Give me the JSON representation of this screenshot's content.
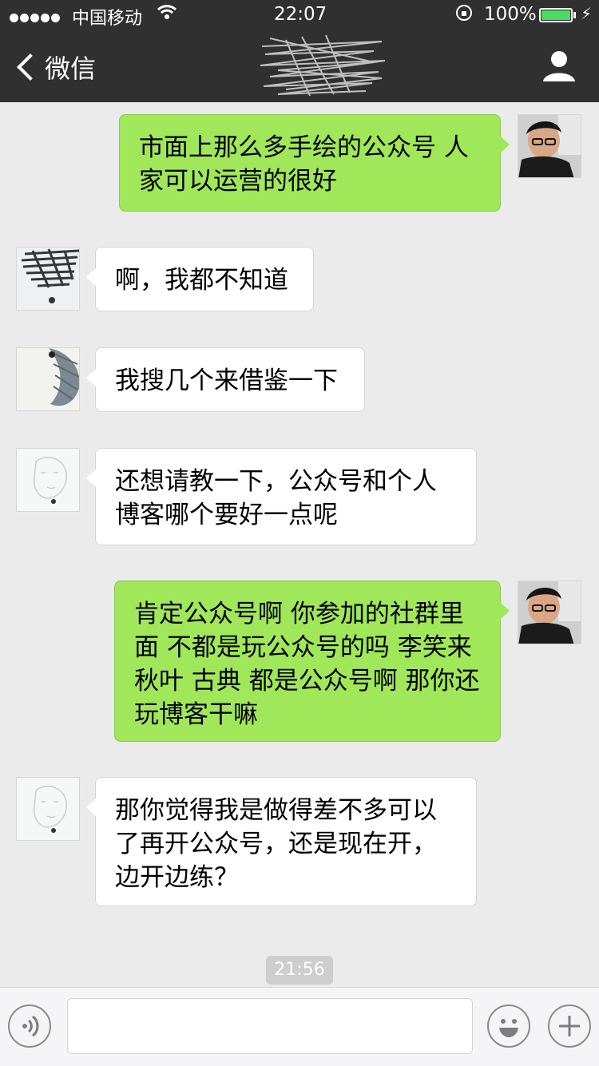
{
  "status_bar": {
    "carrier": "中国移动",
    "time": "22:07",
    "battery_percent": "100%",
    "battery_color": "#4cd964"
  },
  "nav": {
    "back_label": "微信",
    "back_icon": "chevron-left-icon",
    "profile_icon": "person-icon"
  },
  "messages": [
    {
      "side": "sent",
      "text": "市面上那么多手绘的公众号 人家可以运营的很好"
    },
    {
      "side": "received",
      "text": "啊，我都不知道"
    },
    {
      "side": "received",
      "text": "我搜几个来借鉴一下"
    },
    {
      "side": "received",
      "text": "还想请教一下，公众号和个人博客哪个要好一点呢"
    },
    {
      "side": "sent",
      "text": "肯定公众号啊 你参加的社群里面 不都是玩公众号的吗 李笑来 秋叶 古典  都是公众号啊  那你还玩博客干嘛"
    },
    {
      "side": "received",
      "text": "那你觉得我是做得差不多可以了再开公众号，还是现在开，边开边练？"
    }
  ],
  "timestamp": "21:56",
  "input_bar": {
    "voice_icon": "voice-icon",
    "emoji_icon": "emoji-icon",
    "plus_icon": "plus-icon",
    "text_value": ""
  },
  "colors": {
    "header_bg": "#303030",
    "sent_bubble": "#a0e75a",
    "received_bubble": "#ffffff",
    "chat_bg": "#ebebeb"
  }
}
